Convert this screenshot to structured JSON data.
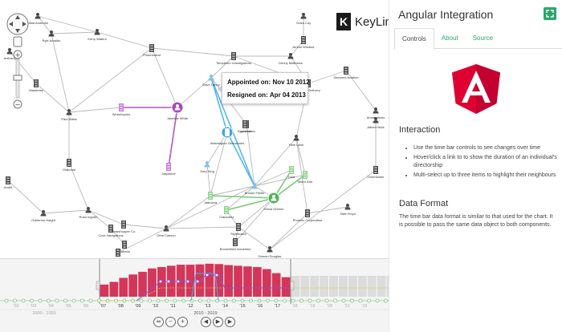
{
  "brand": {
    "logo_letter": "K",
    "logo_text": "KeyLines",
    "accent": "#2fa46b",
    "angular_red": "#c3002f"
  },
  "graph": {
    "nodes": [
      {
        "label": "Hilda Ambrose",
        "kind": "person"
      },
      {
        "label": "Grant Coy",
        "kind": "person"
      },
      {
        "label": "Kerry Waters",
        "kind": "person"
      },
      {
        "label": "Ryle Arnaldo",
        "kind": "person"
      },
      {
        "label": "Phoenixland",
        "kind": "company"
      },
      {
        "label": "Arnold Windsor",
        "kind": "company"
      },
      {
        "label": "Denny Matthews",
        "kind": "person"
      },
      {
        "label": "Templeton Investigations",
        "kind": "company"
      },
      {
        "label": "Dave Laney",
        "kind": "person"
      },
      {
        "label": "Diamond Aviation",
        "kind": "company"
      },
      {
        "label": "Wastedey",
        "kind": "company"
      },
      {
        "label": "Hawkes Delivery",
        "kind": "company"
      },
      {
        "label": "Paul Watts",
        "kind": "person"
      },
      {
        "label": "Wheelcycles",
        "kind": "company"
      },
      {
        "label": "Jasmine White",
        "kind": "person"
      },
      {
        "label": "Cypherdeon",
        "kind": "company"
      },
      {
        "label": "Washington Gemstones",
        "kind": "company"
      },
      {
        "label": "Reel Lane",
        "kind": "person"
      },
      {
        "label": "Altred Hicks",
        "kind": "person"
      },
      {
        "label": "Oldbrook",
        "kind": "company"
      },
      {
        "label": "Gary King",
        "kind": "person"
      },
      {
        "label": "Jasperine",
        "kind": "company"
      },
      {
        "label": "Brooke Fields",
        "kind": "person"
      },
      {
        "label": "Gold",
        "kind": "company"
      },
      {
        "label": "Metro Arts",
        "kind": "company"
      },
      {
        "label": "Greenwater",
        "kind": "company"
      },
      {
        "label": "Jalbuana",
        "kind": "company"
      },
      {
        "label": "Dania Greene",
        "kind": "person"
      },
      {
        "label": "Clausdest",
        "kind": "company"
      },
      {
        "label": "Guillermo Haight",
        "kind": "person"
      },
      {
        "label": "Rosa Ingram",
        "kind": "person"
      },
      {
        "label": "Phoenix Corporation",
        "kind": "company"
      },
      {
        "label": "Taite Floyd",
        "kind": "person"
      },
      {
        "label": "Cove Navigations",
        "kind": "company"
      },
      {
        "label": "Grasshopper Co.",
        "kind": "company"
      },
      {
        "label": "Gina Carlson",
        "kind": "person"
      },
      {
        "label": "Stylematch",
        "kind": "company"
      },
      {
        "label": "Rubedo",
        "kind": "company"
      },
      {
        "label": "Checkham Security",
        "kind": "company"
      },
      {
        "label": "Boomefield Industries",
        "kind": "company"
      },
      {
        "label": "Damon Douglas",
        "kind": "person"
      },
      {
        "label": "Cyclonian",
        "kind": "company"
      },
      {
        "label": "Ahmet Hicks",
        "kind": "person"
      },
      {
        "label": "Anthony",
        "kind": "person"
      },
      {
        "label": "Ambit",
        "kind": "company"
      }
    ]
  },
  "tooltip": {
    "appointed_label": "Appointed on:",
    "appointed_value": "Nov 10 2012",
    "resigned_label": "Resigned on:",
    "resigned_value": "Apr 04 2013"
  },
  "timebar": {
    "year_ticks": [
      "'02",
      "'03",
      "'04",
      "'05",
      "'06",
      "'07",
      "'08",
      "'09",
      "'10",
      "'11",
      "'12",
      "'13",
      "'14",
      "'15",
      "'16",
      "'17",
      "'18",
      "'19",
      "'20",
      "'21",
      "'22"
    ],
    "decade_labels": [
      "2000 - 2009",
      "2010 - 2019"
    ],
    "bar_values": [
      0.36,
      0.44,
      0.56,
      0.66,
      0.74,
      0.84,
      0.88,
      0.92,
      0.95,
      0.95,
      0.96,
      0.98,
      0.97,
      0.94,
      0.92,
      0.9,
      0.88,
      0.82,
      0.7,
      0.58
    ],
    "bar_color": "#d4365a",
    "future_color": "#dcdcdc"
  },
  "panel": {
    "title": "Angular Integration",
    "tabs": [
      "Controls",
      "About",
      "Source"
    ],
    "interaction_heading": "Interaction",
    "interaction_items": [
      "Use the time bar controls to see changes over time",
      "Hover/click a link to to show the duration of an individual's directorship",
      "Multi-select up to three items to highlight their neighbours"
    ],
    "data_format_heading": "Data Format",
    "data_format_text": "The time bar data format is similar to that used for the chart. It is possible to pass the same data object to both components."
  }
}
